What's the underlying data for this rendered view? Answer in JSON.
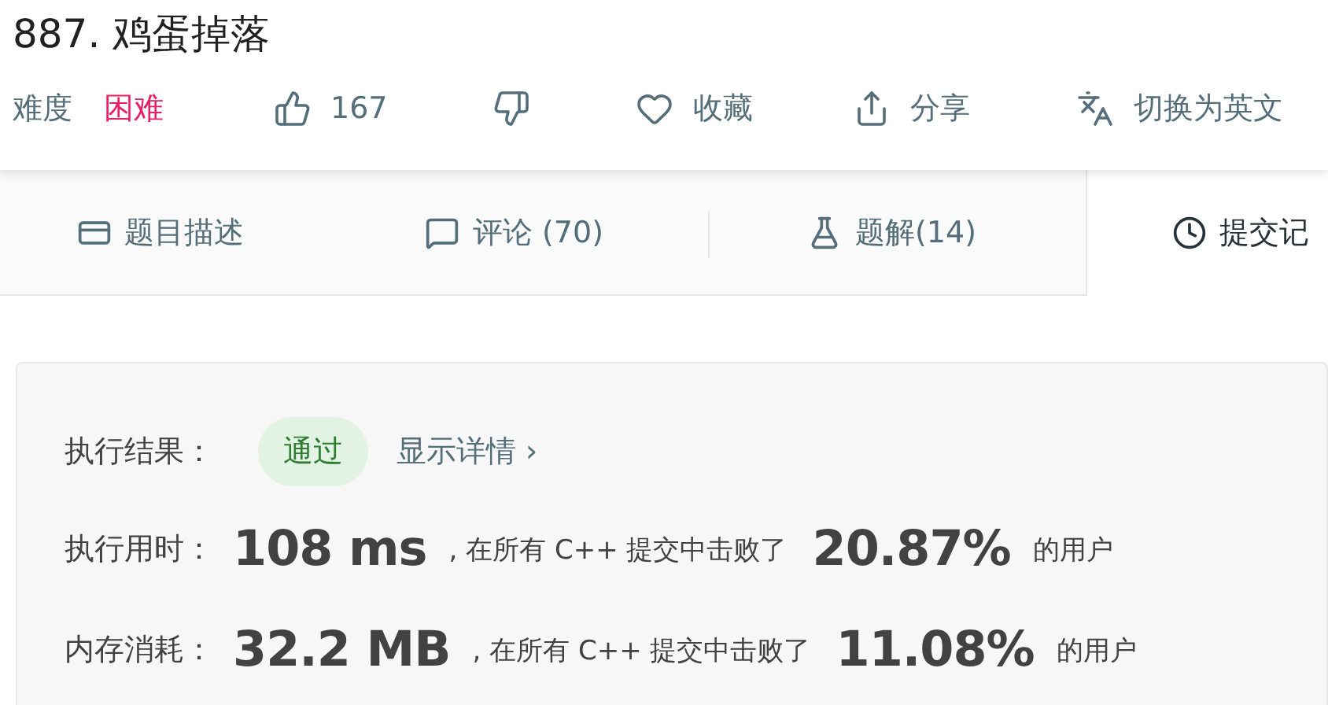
{
  "problem": {
    "title": "887. 鸡蛋掉落"
  },
  "meta": {
    "difficulty_label": "难度",
    "difficulty": "困难",
    "likes": "167",
    "favorite": "收藏",
    "share": "分享",
    "translate": "切换为英文"
  },
  "tabs": [
    {
      "kind": "description",
      "label": "题目描述",
      "selected": false
    },
    {
      "kind": "comments",
      "label": "评论 (70)",
      "selected": false
    },
    {
      "kind": "solutions",
      "label": "题解(14)",
      "selected": false
    },
    {
      "kind": "submissions",
      "label": "提交记",
      "selected": true
    }
  ],
  "result": {
    "label": "执行结果：",
    "status": "通过",
    "details_link": "显示详情 ›",
    "metrics": [
      {
        "label": "执行用时：",
        "value": "108 ms",
        "text": ", 在所有 C++ 提交中击败了",
        "percent": "20.87%",
        "suffix": "的用户"
      },
      {
        "label": "内存消耗：",
        "value": "32.2 MB",
        "text": ", 在所有 C++ 提交中击败了",
        "percent": "11.08%",
        "suffix": "的用户"
      }
    ]
  }
}
